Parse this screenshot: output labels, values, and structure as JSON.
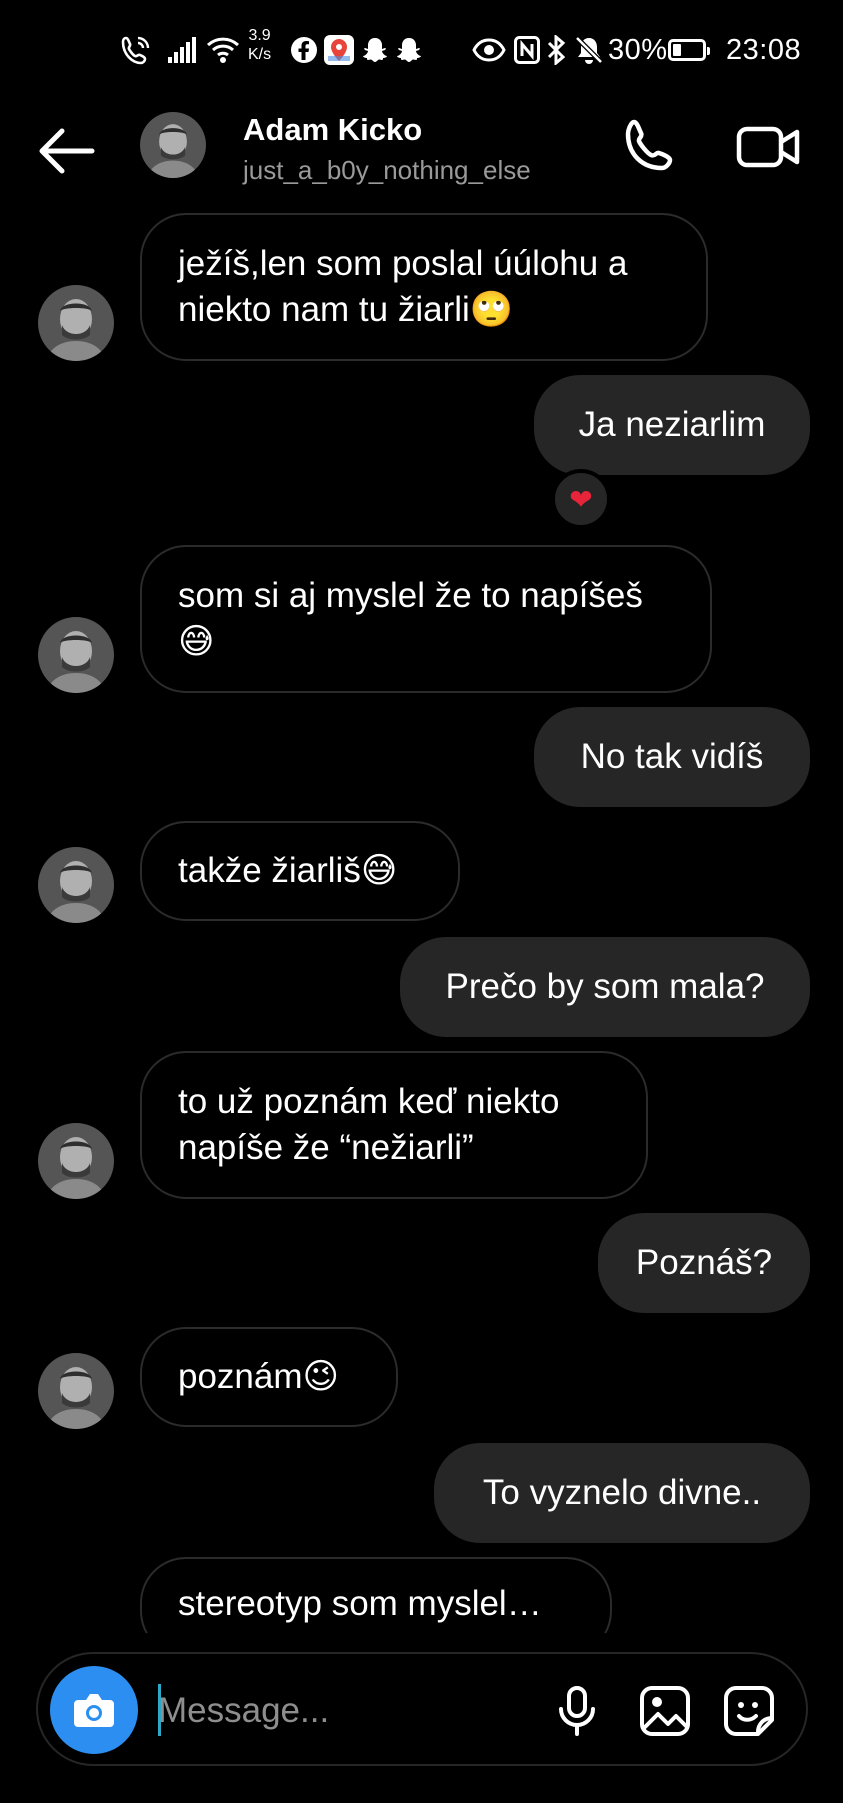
{
  "status_bar": {
    "net_speed_value": "3.9",
    "net_speed_unit": "K/s",
    "battery": "30%",
    "battery_level": 0.3,
    "time": "23:08"
  },
  "header": {
    "name": "Adam Kicko",
    "username": "just_a_b0y_nothing_else"
  },
  "messages": [
    {
      "from": "them",
      "text": "ježíš,len som poslal úúlohu a niekto nam tu žiarli🙄"
    },
    {
      "from": "me",
      "text": "Ja neziarlim",
      "reaction": "❤"
    },
    {
      "from": "them",
      "text": "som si aj myslel že to napíšeš 😅"
    },
    {
      "from": "me",
      "text": "No tak vidíš"
    },
    {
      "from": "them",
      "text": "takže žiarliš😅"
    },
    {
      "from": "me",
      "text": "Prečo by som mala?"
    },
    {
      "from": "them",
      "text": "to už poznám keď niekto napíše že “nežiarli”"
    },
    {
      "from": "me",
      "text": "Poznáš?"
    },
    {
      "from": "them",
      "text": "poznám😉"
    },
    {
      "from": "me",
      "text": "To vyznelo divne.."
    },
    {
      "from": "them",
      "text": "stereotyp som myslel…"
    }
  ],
  "composer": {
    "placeholder": "Message..."
  },
  "colors": {
    "background": "#000000",
    "outgoing_bubble": "#262626",
    "incoming_border": "#2b2b2b",
    "camera_button": "#2b8ef0",
    "reaction_heart": "#e8243a"
  }
}
